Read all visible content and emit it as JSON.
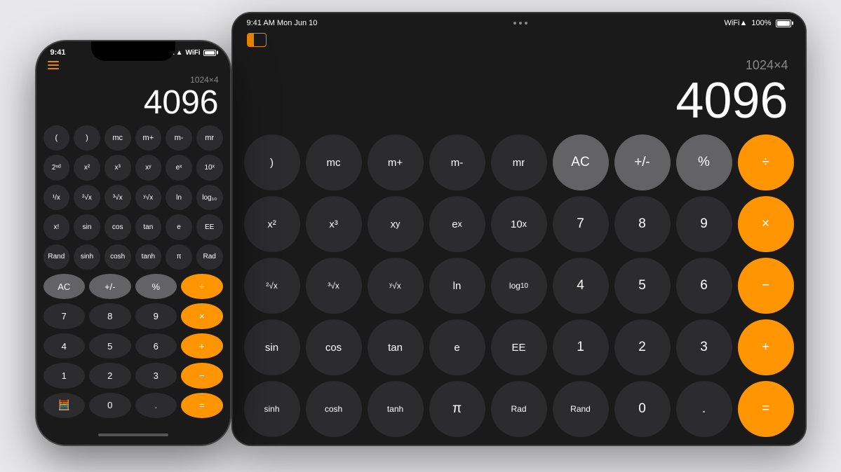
{
  "ipad": {
    "status": {
      "time": "9:41 AM Mon Jun 10",
      "wifi": "WiFi",
      "battery": "100%",
      "battery_label": "100%"
    },
    "expression": "1024×4",
    "result": "4096",
    "rows": [
      [
        ")",
        "mc",
        "m+",
        "m-",
        "mr",
        "AC",
        "+/-",
        "%",
        "÷"
      ],
      [
        "x²",
        "x³",
        "xʸ",
        "eˣ",
        "10ˣ",
        "7",
        "8",
        "9",
        "×"
      ],
      [
        "²√x",
        "³√x",
        "ʸ√x",
        "ln",
        "log₁₀",
        "4",
        "5",
        "6",
        "−"
      ],
      [
        "sin",
        "cos",
        "tan",
        "e",
        "EE",
        "1",
        "2",
        "3",
        "+"
      ],
      [
        "sinh",
        "cosh",
        "tanh",
        "π",
        "Rad",
        "Rand",
        "0",
        ".",
        "="
      ]
    ],
    "btn_types": [
      [
        "dark",
        "dark",
        "dark",
        "dark",
        "dark",
        "gray",
        "gray",
        "gray",
        "orange"
      ],
      [
        "dark",
        "dark",
        "dark",
        "dark",
        "dark",
        "dark",
        "dark",
        "dark",
        "orange"
      ],
      [
        "dark",
        "dark",
        "dark",
        "dark",
        "dark",
        "dark",
        "dark",
        "dark",
        "orange"
      ],
      [
        "dark",
        "dark",
        "dark",
        "dark",
        "dark",
        "dark",
        "dark",
        "dark",
        "orange"
      ],
      [
        "dark",
        "dark",
        "dark",
        "dark",
        "dark",
        "dark",
        "dark",
        "dark",
        "orange"
      ]
    ]
  },
  "iphone": {
    "status": {
      "time": "9:41",
      "signal": "●●●●",
      "wifi": "WiFi",
      "battery": "■"
    },
    "expression": "1024×4",
    "result": "4096",
    "rows": [
      [
        "(",
        ")",
        "mc",
        "m+",
        "m-",
        "mr"
      ],
      [
        "2ⁿᵈ",
        "x²",
        "x³",
        "xʸ",
        "eˣ",
        "10ˣ"
      ],
      [
        "¹/x",
        "²√x",
        "³√x",
        "ʸ√x",
        "ln",
        "log₁₀"
      ],
      [
        "x!",
        "sin",
        "cos",
        "tan",
        "e",
        "EE"
      ],
      [
        "Rand",
        "sinh",
        "cosh",
        "tanh",
        "π",
        "Rad"
      ],
      [
        "AC",
        "+/-",
        "%",
        "÷"
      ],
      [
        "7",
        "8",
        "9",
        "×"
      ],
      [
        "4",
        "5",
        "6",
        "+"
      ],
      [
        "1",
        "2",
        "3",
        "−"
      ],
      [
        "🧮",
        "0",
        ".",
        "="
      ]
    ],
    "row_types6": [
      "gray",
      "gray",
      "gray",
      "orange"
    ],
    "row_types7": [
      "dark",
      "dark",
      "dark",
      "orange"
    ],
    "row_types8": [
      "dark",
      "dark",
      "dark",
      "orange"
    ],
    "row_types9": [
      "dark",
      "dark",
      "dark",
      "orange"
    ],
    "row_types10": [
      "dark",
      "dark",
      "dark",
      "orange"
    ]
  }
}
